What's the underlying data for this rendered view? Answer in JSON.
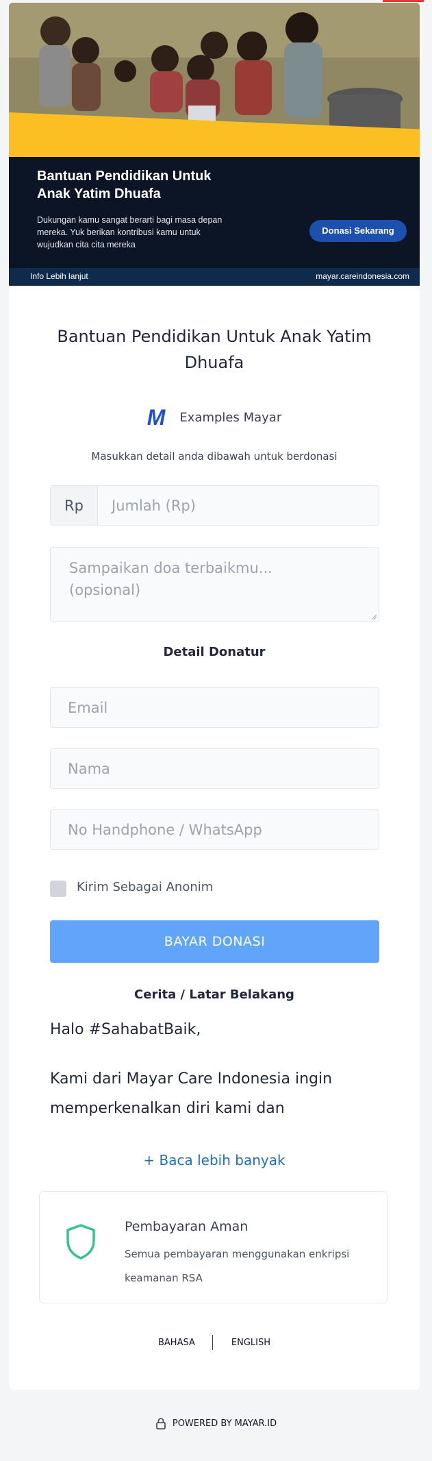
{
  "banner": {
    "title": "Bantuan Pendidikan Untuk Anak Yatim Dhuafa",
    "description": "Dukungan kamu sangat berarti bagi masa depan mereka. Yuk berikan kontribusi kamu untuk wujudkan cita cita mereka",
    "cta_label": "Donasi Sekarang",
    "info_label": "Info Lebih lanjut",
    "site": "mayar.careindonesia.com"
  },
  "page": {
    "title": "Bantuan Pendidikan Untuk Anak Yatim Dhuafa",
    "merchant_logo": "M",
    "merchant_name": "Examples Mayar",
    "instruction": "Masukkan detail anda dibawah untuk berdonasi"
  },
  "form": {
    "currency_prefix": "Rp",
    "amount_placeholder": "Jumlah (Rp)",
    "prayer_placeholder": "Sampaikan doa terbaikmu... (opsional)",
    "donor_section_title": "Detail Donatur",
    "email_placeholder": "Email",
    "name_placeholder": "Nama",
    "phone_placeholder": "No Handphone / WhatsApp",
    "anonymous_label": "Kirim Sebagai Anonim",
    "anonymous_checked": false,
    "submit_label": "BAYAR DONASI"
  },
  "story": {
    "section_title": "Cerita / Latar Belakang",
    "greeting": "Halo #SahabatBaik,",
    "excerpt": "Kami dari Mayar Care Indonesia ingin memperkenalkan diri kami dan",
    "read_more": "+ Baca lebih banyak"
  },
  "secure": {
    "icon": "shield-icon",
    "title": "Pembayaran Aman",
    "description": "Semua pembayaran menggunakan enkripsi keamanan RSA"
  },
  "language": {
    "label": "BAHASA",
    "current": "ENGLISH"
  },
  "footer": {
    "icon": "lock-icon",
    "powered_by": "POWERED BY MAYAR.ID"
  },
  "colors": {
    "accent_yellow": "#fbbf24",
    "banner_navy": "#0b1526",
    "cta_blue": "#1d4fae",
    "submit_blue": "#60a5fa",
    "link_blue": "#1d6fb8",
    "shield_green": "#34c38f"
  }
}
